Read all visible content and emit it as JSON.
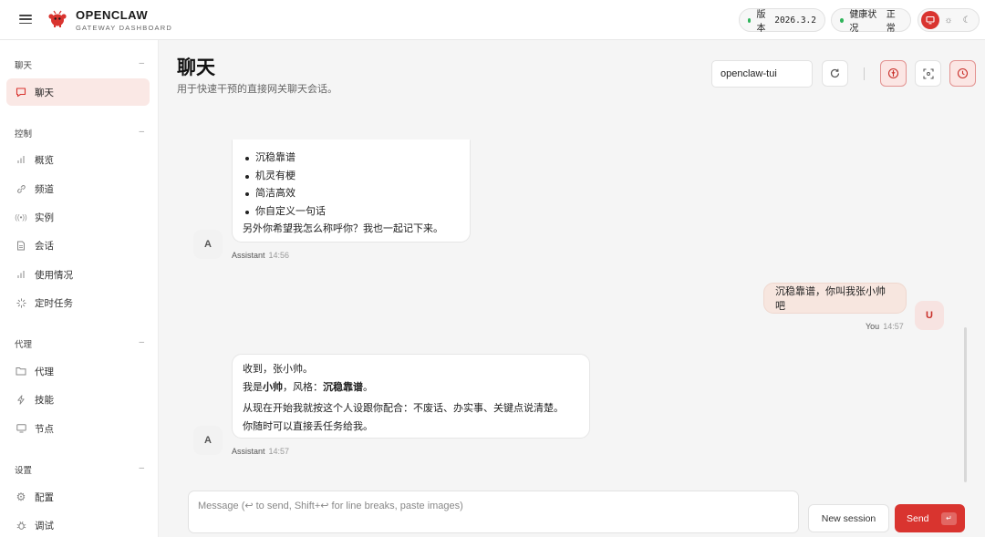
{
  "app": {
    "title": "OPENCLAW",
    "subtitle": "GATEWAY DASHBOARD",
    "accent": "#d9342f"
  },
  "status": {
    "version_label": "版本",
    "version_value": "2026.3.2",
    "health_label": "健康状况",
    "health_value": "正常",
    "health_color": "#2fb45a"
  },
  "theme": {
    "options": [
      "monitor-icon",
      "sun-icon",
      "moon-icon"
    ],
    "selected": "monitor-icon"
  },
  "sidebar": {
    "sections": [
      {
        "title": "聊天",
        "items": [
          {
            "label": "聊天",
            "icon": "chat-icon",
            "active": true
          }
        ]
      },
      {
        "title": "控制",
        "items": [
          {
            "label": "概览",
            "icon": "bar-chart-icon"
          },
          {
            "label": "频道",
            "icon": "link-icon"
          },
          {
            "label": "实例",
            "icon": "radio-icon"
          },
          {
            "label": "会话",
            "icon": "document-icon"
          },
          {
            "label": "使用情况",
            "icon": "bar-chart-icon"
          },
          {
            "label": "定时任务",
            "icon": "loader-icon"
          }
        ]
      },
      {
        "title": "代理",
        "items": [
          {
            "label": "代理",
            "icon": "folder-icon"
          },
          {
            "label": "技能",
            "icon": "lightning-icon"
          },
          {
            "label": "节点",
            "icon": "monitor-icon"
          }
        ]
      },
      {
        "title": "设置",
        "items": [
          {
            "label": "配置",
            "icon": "gear-icon"
          },
          {
            "label": "调试",
            "icon": "bug-icon"
          }
        ]
      }
    ]
  },
  "header": {
    "title": "聊天",
    "subtitle": "用于快速干预的直接网关聊天会话。",
    "session_value": "openclaw-tui"
  },
  "messages": [
    {
      "role": "Assistant",
      "avatar": "A",
      "time": "14:56",
      "list": [
        "沉稳靠谱",
        "机灵有梗",
        "简洁高效",
        "你自定义一句话"
      ],
      "tail": "另外你希望我怎么称呼你？我也一起记下来。"
    },
    {
      "role": "You",
      "avatar": "U",
      "time": "14:57",
      "text": "沉稳靠谱，你叫我张小帅吧"
    },
    {
      "role": "Assistant",
      "avatar": "A",
      "time": "14:57",
      "line1": "收到，张小帅。",
      "line2_pre": "我是",
      "line2_name": "小帅",
      "line2_mid": "，风格：",
      "line2_style": "沉稳靠谱",
      "line2_end": "。",
      "line3": "从现在开始我就按这个人设跟你配合：不废话、办实事、关键点说清楚。",
      "line4": "你随时可以直接丢任务给我。"
    }
  ],
  "composer": {
    "placeholder": "Message (↩ to send, Shift+↩ for line breaks, paste images)",
    "new_session_label": "New session",
    "send_label": "Send",
    "send_kbd": "↵"
  }
}
